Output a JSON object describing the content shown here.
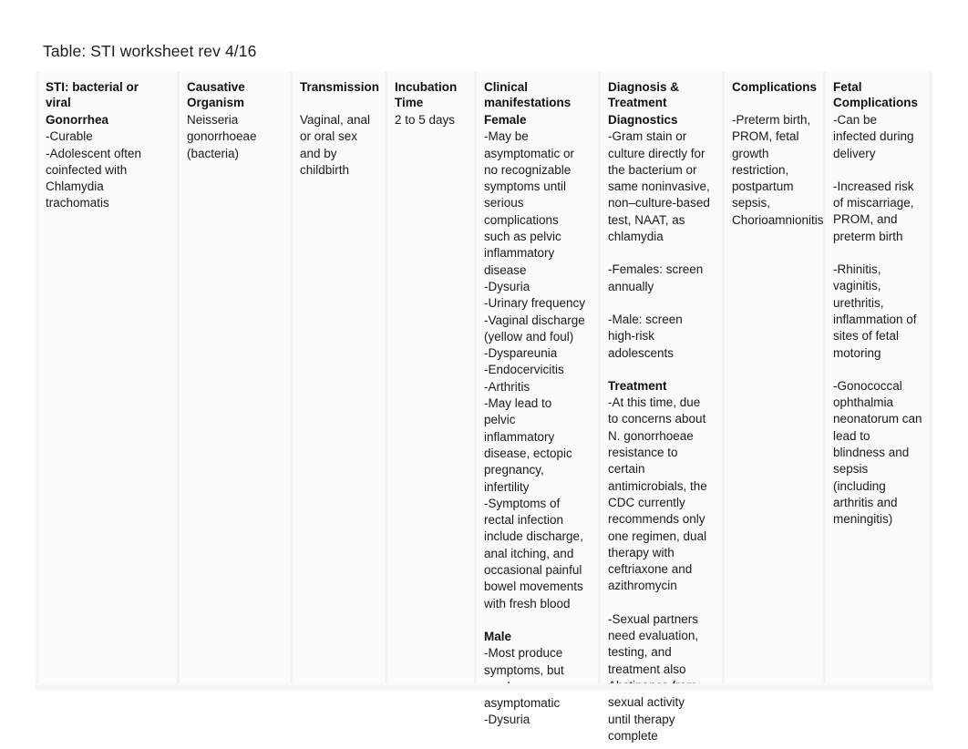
{
  "document": {
    "title": "Table: STI worksheet rev 4/16"
  },
  "table": {
    "headers": [
      "STI: bacterial or viral",
      "Causative Organism",
      "Transmission",
      "Incubation Time",
      "Clinical manifestations",
      "Diagnosis & Treatment",
      "Complications",
      "Fetal Complications"
    ],
    "row": {
      "sti": {
        "name": "Gonorrhea",
        "notes": "-Curable\n-Adolescent often coinfected with Chlamydia trachomatis"
      },
      "organism": "Neisseria gonorrhoeae (bacteria)",
      "transmission": "Vaginal, anal or oral sex and by childbirth",
      "incubation": "2 to 5 days",
      "clinical": {
        "female_label": "Female",
        "female_notes": "-May be asymptomatic or no recognizable symptoms until serious complications such as pelvic inflammatory disease\n-Dysuria\n-Urinary frequency\n-Vaginal discharge (yellow and foul)\n-Dyspareunia\n-Endocervicitis\n-Arthritis\n-May lead to pelvic inflammatory disease, ectopic pregnancy, infertility\n-Symptoms of rectal infection include discharge, anal itching, and occasional painful bowel movements with fresh blood",
        "male_label": "Male",
        "male_notes": "-Most produce symptoms, but can be asymptomatic\n-Dysuria"
      },
      "diagnosis_treatment": {
        "diagnostics_label": "Diagnostics",
        "diagnostics_notes": "-Gram stain or culture directly for the bacterium or same noninvasive, non–culture-based test, NAAT, as chlamydia",
        "diagnostics_females": "-Females: screen annually",
        "diagnostics_males": "-Male: screen high-risk adolescents",
        "treatment_label": "Treatment",
        "treatment_notes": "-At this time, due to concerns about N. gonorrhoeae resistance to certain antimicrobials, the CDC currently recommends only one regimen, dual therapy with ceftriaxone and azithromycin",
        "treatment_partners": "-Sexual partners need evaluation, testing, and treatment also Abstinence from sexual activity until therapy complete"
      },
      "complications": "-Preterm birth, PROM, fetal growth restriction, postpartum sepsis, Chorioamnionitis",
      "fetal_complications": {
        "item1": "-Can be infected during delivery",
        "item2": "-Increased risk of miscarriage, PROM, and preterm birth",
        "item3": "-Rhinitis, vaginitis, urethritis, inflammation of sites of fetal motoring",
        "item4": "-Gonococcal ophthalmia neonatorum can lead to blindness and sepsis (including arthritis and meningitis)"
      }
    }
  },
  "colors": {
    "page_background": "#ffffff",
    "table_tint": "#fbfbfb",
    "text": "#1a1a1a",
    "heading_text": "#101010",
    "column_separator": "#f0f0f0"
  }
}
